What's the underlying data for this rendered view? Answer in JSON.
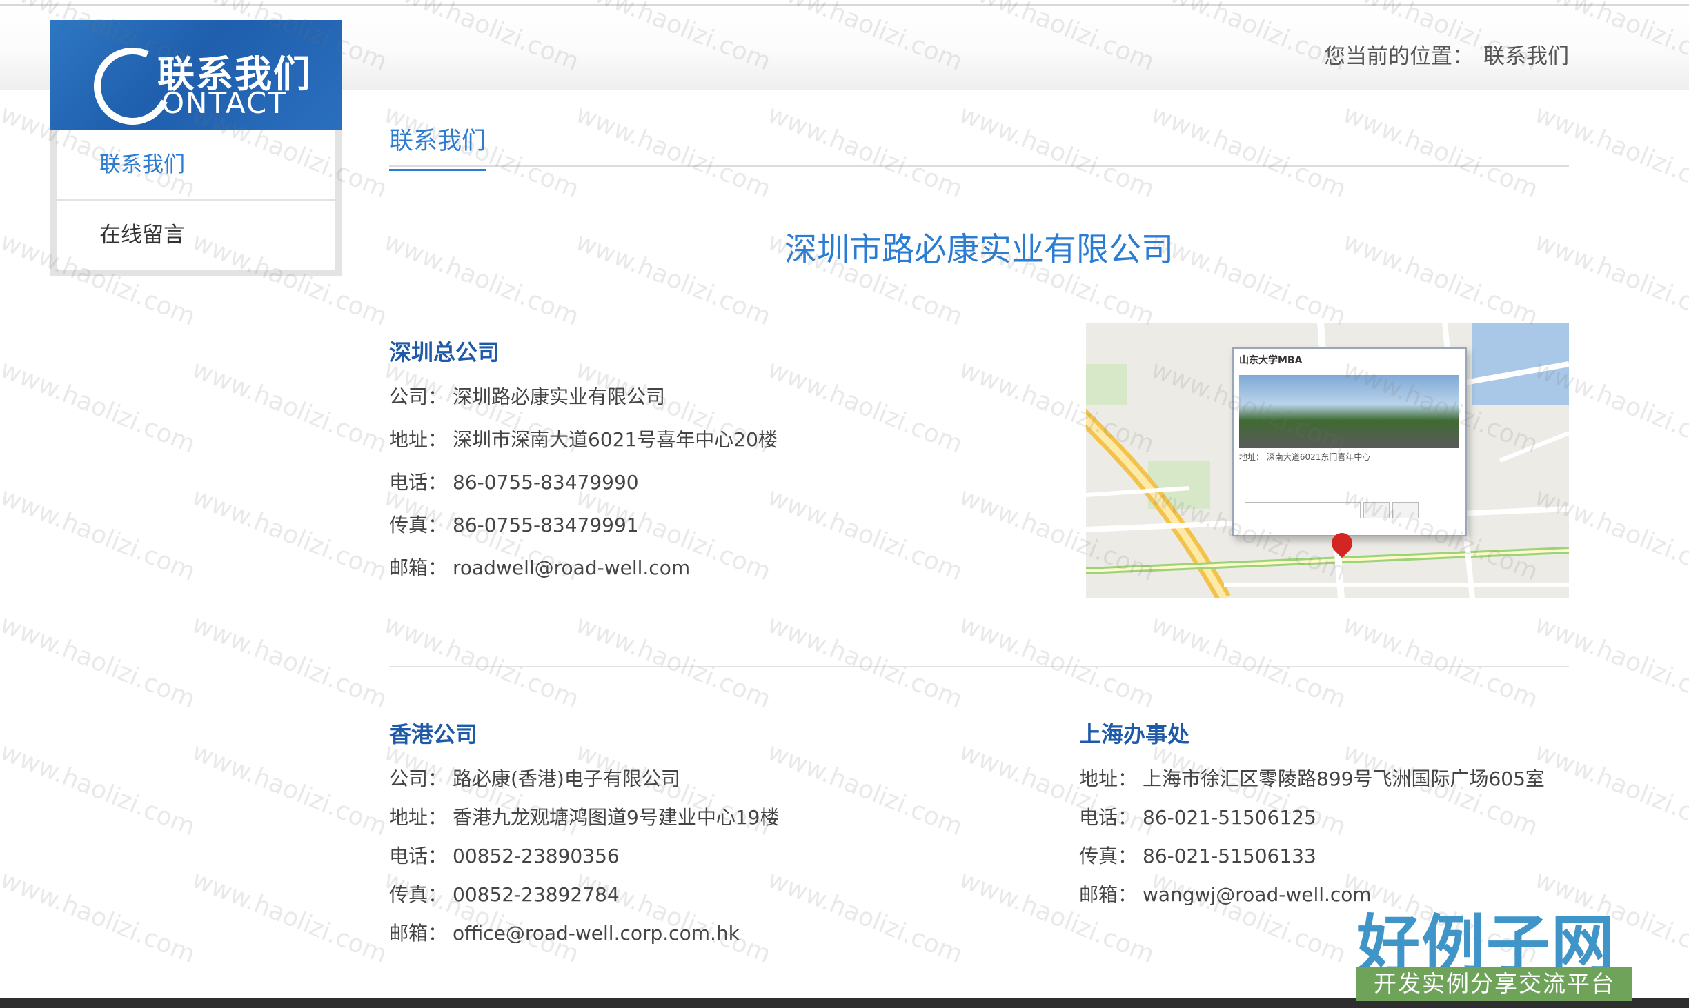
{
  "sidebar": {
    "banner_cn": "联系我们",
    "banner_en": "ONTACT",
    "items": [
      {
        "label": "联系我们",
        "active": true
      },
      {
        "label": "在线留言",
        "active": false
      }
    ]
  },
  "breadcrumb": {
    "prefix": "您当前的位置：",
    "current": "联系我们"
  },
  "main": {
    "tab_label": "联系我们",
    "company_title": "深圳市路必康实业有限公司"
  },
  "offices": {
    "shenzhen": {
      "title": "深圳总公司",
      "rows": [
        {
          "label": "公司：",
          "value": "深圳路必康实业有限公司"
        },
        {
          "label": "地址：",
          "value": "深圳市深南大道6021号喜年中心20楼"
        },
        {
          "label": "电话：",
          "value": "86-0755-83479990"
        },
        {
          "label": "传真：",
          "value": "86-0755-83479991"
        },
        {
          "label": "邮箱：",
          "value": "roadwell@road-well.com"
        }
      ]
    },
    "hongkong": {
      "title": "香港公司",
      "rows": [
        {
          "label": "公司：",
          "value": "路必康(香港)电子有限公司"
        },
        {
          "label": "地址：",
          "value": "香港九龙观塘鸿图道9号建业中心19楼"
        },
        {
          "label": "电话：",
          "value": "00852-23890356"
        },
        {
          "label": "传真：",
          "value": "00852-23892784"
        },
        {
          "label": "邮箱：",
          "value": "office@road-well.corp.com.hk"
        }
      ]
    },
    "shanghai": {
      "title": "上海办事处",
      "rows": [
        {
          "label": "地址：",
          "value": "上海市徐汇区零陵路899号飞洲国际广场605室"
        },
        {
          "label": "电话：",
          "value": "86-021-51506125"
        },
        {
          "label": "传真：",
          "value": "86-021-51506133"
        },
        {
          "label": "邮箱：",
          "value": "wangwj@road-well.com"
        }
      ]
    }
  },
  "map": {
    "popup_title": "山东大学MBA",
    "popup_address": "地址： 深南大道6021东门喜年中心"
  },
  "watermark": {
    "text": "www.haolizi.com"
  },
  "brand": {
    "main": "好例子网",
    "sub": "开发实例分享交流平台"
  },
  "colors": {
    "accent": "#2b7cd3",
    "heading": "#1e5aa8",
    "banner": "#2a6fbe"
  }
}
